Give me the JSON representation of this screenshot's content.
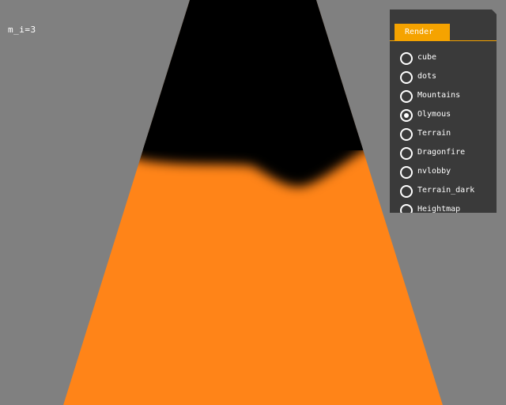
{
  "debug_label": "m_i=3",
  "panel": {
    "tab_label": "Render",
    "options": [
      {
        "label": "cube",
        "selected": false
      },
      {
        "label": "dots",
        "selected": false
      },
      {
        "label": "Mountains",
        "selected": false
      },
      {
        "label": "Olymous",
        "selected": true
      },
      {
        "label": "Terrain",
        "selected": false
      },
      {
        "label": "Dragonfire",
        "selected": false
      },
      {
        "label": "nvlobby",
        "selected": false
      },
      {
        "label": "Terrain_dark",
        "selected": false
      },
      {
        "label": "Heightmap",
        "selected": false
      }
    ]
  },
  "colors": {
    "background": "#808080",
    "surface": "#ff8418",
    "sky": "#000000",
    "panel": "#3a3a3a",
    "accent": "#f5a300",
    "text": "#ffffff"
  }
}
